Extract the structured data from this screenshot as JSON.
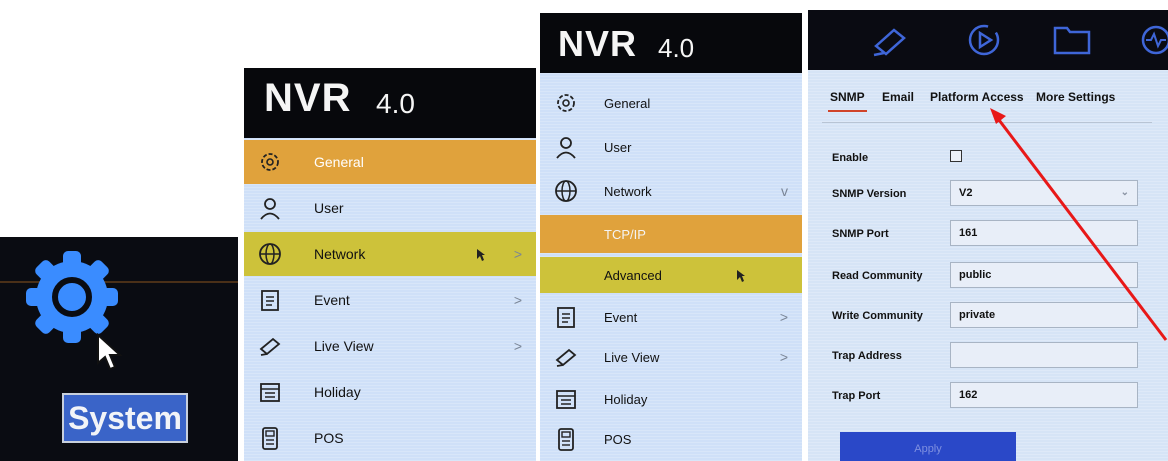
{
  "panel1": {
    "label": "System",
    "icon": "gear-icon"
  },
  "panel2": {
    "brand": {
      "name": "NVR",
      "version": "4.0"
    },
    "items": [
      {
        "label": "General",
        "icon": "gear-icon",
        "chevron": ""
      },
      {
        "label": "User",
        "icon": "user-icon",
        "chevron": ""
      },
      {
        "label": "Network",
        "icon": "globe-icon",
        "chevron": ">"
      },
      {
        "label": "Event",
        "icon": "clipboard-icon",
        "chevron": ">"
      },
      {
        "label": "Live View",
        "icon": "camera-icon",
        "chevron": ">"
      },
      {
        "label": "Holiday",
        "icon": "calendar-icon",
        "chevron": ""
      },
      {
        "label": "POS",
        "icon": "pos-icon",
        "chevron": ""
      }
    ]
  },
  "panel3": {
    "brand": {
      "name": "NVR",
      "version": "4.0"
    },
    "items": [
      {
        "label": "General",
        "chevron": ""
      },
      {
        "label": "User",
        "chevron": ""
      },
      {
        "label": "Network",
        "chevron": "v"
      },
      {
        "label": "TCP/IP",
        "chevron": ""
      },
      {
        "label": "Advanced",
        "chevron": ""
      },
      {
        "label": "Event",
        "chevron": ">"
      },
      {
        "label": "Live View",
        "chevron": ">"
      },
      {
        "label": "Holiday",
        "chevron": ""
      },
      {
        "label": "POS",
        "chevron": ""
      }
    ]
  },
  "panel4": {
    "tabs": [
      "SNMP",
      "Email",
      "Platform Access",
      "More Settings"
    ],
    "active_tab": "SNMP",
    "fields": {
      "enable_label": "Enable",
      "snmp_version_label": "SNMP Version",
      "snmp_version_value": "V2",
      "snmp_port_label": "SNMP Port",
      "snmp_port_value": "161",
      "read_community_label": "Read Community",
      "read_community_value": "public",
      "write_community_label": "Write Community",
      "write_community_value": "private",
      "trap_address_label": "Trap Address",
      "trap_address_value": "",
      "trap_port_label": "Trap Port",
      "trap_port_value": "162"
    },
    "apply_label": "Apply"
  },
  "colors": {
    "menu_bg": "#cfe0f8",
    "highlight_orange": "#e0a23c",
    "highlight_yellow": "#cdc23a",
    "system_blue": "#3a8cff",
    "arrow_red": "#e81818",
    "apply_blue": "#2a48c8"
  }
}
